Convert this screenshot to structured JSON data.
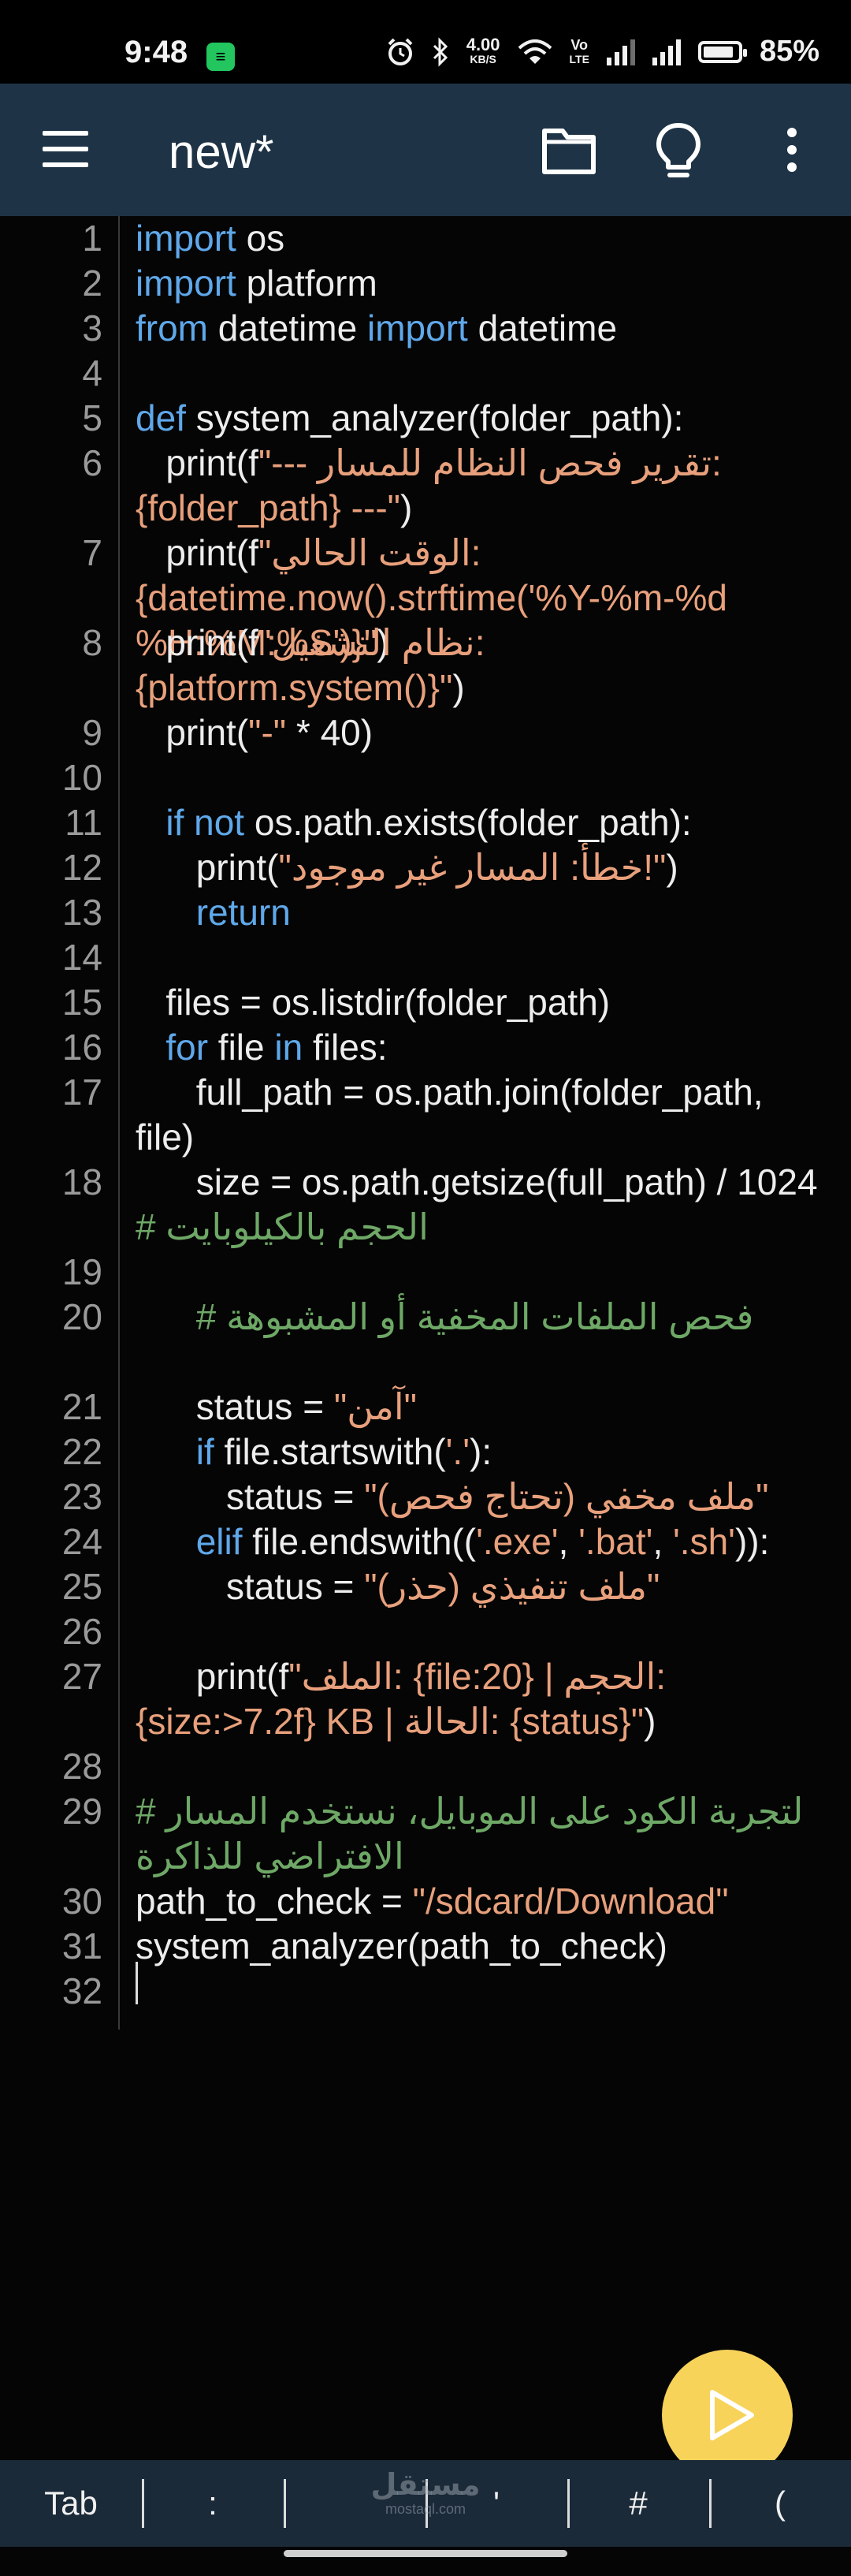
{
  "status_bar": {
    "time": "9:48",
    "app_icon_glyph": "≡",
    "alarm_icon": "alarm-icon",
    "bluetooth_icon": "bluetooth-icon",
    "net_speed_value": "4.00",
    "net_speed_unit": "KB/S",
    "wifi_icon": "wifi-icon",
    "volte_top": "Vo",
    "volte_bottom": "LTE",
    "battery_percent": "85%",
    "battery_level": 0.85
  },
  "toolbar": {
    "menu_icon": "menu-icon",
    "title": "new*",
    "folder_icon": "folder-icon",
    "bulb_icon": "lightbulb-icon",
    "more_icon": "more-vert-icon"
  },
  "editor": {
    "lines": [
      {
        "n": "1",
        "parts": [
          {
            "t": "import",
            "c": "kw"
          },
          {
            "t": " os",
            "c": ""
          }
        ]
      },
      {
        "n": "2",
        "parts": [
          {
            "t": "import",
            "c": "kw"
          },
          {
            "t": " platform",
            "c": ""
          }
        ]
      },
      {
        "n": "3",
        "parts": [
          {
            "t": "from",
            "c": "kw"
          },
          {
            "t": " datetime ",
            "c": ""
          },
          {
            "t": "import",
            "c": "kw"
          },
          {
            "t": " datetime",
            "c": ""
          }
        ]
      },
      {
        "n": "4",
        "parts": []
      },
      {
        "n": "5",
        "parts": [
          {
            "t": "def",
            "c": "kw"
          },
          {
            "t": " system_analyzer(folder_path):",
            "c": ""
          }
        ]
      },
      {
        "n": "6",
        "parts": [
          {
            "t": "   print(f",
            "c": ""
          },
          {
            "t": "\"--- تقرير فحص النظام للمسار: {folder_path} ---\"",
            "c": "str"
          },
          {
            "t": ")",
            "c": ""
          }
        ]
      },
      {
        "n": "7",
        "parts": [
          {
            "t": "   print(f",
            "c": ""
          },
          {
            "t": "\"الوقت الحالي: {datetime.now().strftime('%Y-%m-%d %H:%M:%S')}\"",
            "c": "str"
          },
          {
            "t": ")",
            "c": ""
          }
        ]
      },
      {
        "n": "8",
        "parts": [
          {
            "t": "   print(f",
            "c": ""
          },
          {
            "t": "\"نظام التشغيل: {platform.system()}\"",
            "c": "str"
          },
          {
            "t": ")",
            "c": ""
          }
        ]
      },
      {
        "n": "9",
        "parts": [
          {
            "t": "   print(",
            "c": ""
          },
          {
            "t": "\"-\"",
            "c": "str"
          },
          {
            "t": " * 40)",
            "c": ""
          }
        ]
      },
      {
        "n": "10",
        "parts": []
      },
      {
        "n": "11",
        "parts": [
          {
            "t": "   ",
            "c": ""
          },
          {
            "t": "if not",
            "c": "kw"
          },
          {
            "t": " os.path.exists(folder_path):",
            "c": ""
          }
        ]
      },
      {
        "n": "12",
        "parts": [
          {
            "t": "      print(",
            "c": ""
          },
          {
            "t": "\"خطأ: المسار غير موجود!\"",
            "c": "str"
          },
          {
            "t": ")",
            "c": ""
          }
        ]
      },
      {
        "n": "13",
        "parts": [
          {
            "t": "      ",
            "c": ""
          },
          {
            "t": "return",
            "c": "kw"
          }
        ]
      },
      {
        "n": "14",
        "parts": []
      },
      {
        "n": "15",
        "parts": [
          {
            "t": "   files = os.listdir(folder_path)",
            "c": ""
          }
        ]
      },
      {
        "n": "16",
        "parts": [
          {
            "t": "   ",
            "c": ""
          },
          {
            "t": "for",
            "c": "kw"
          },
          {
            "t": " file ",
            "c": ""
          },
          {
            "t": "in",
            "c": "kw"
          },
          {
            "t": " files:",
            "c": ""
          }
        ]
      },
      {
        "n": "17",
        "parts": [
          {
            "t": "      full_path = os.path.join(folder_path, file)",
            "c": ""
          }
        ]
      },
      {
        "n": "18",
        "parts": [
          {
            "t": "      size = os.path.getsize(full_path) / 1024  ",
            "c": ""
          },
          {
            "t": "# الحجم بالكيلوبايت",
            "c": "cm"
          }
        ]
      },
      {
        "n": "19",
        "parts": []
      },
      {
        "n": "20",
        "parts": [
          {
            "t": "      ",
            "c": ""
          },
          {
            "t": "# فحص الملفات المخفية أو المشبوهة",
            "c": "cm"
          }
        ]
      },
      {
        "n": "21",
        "parts": [
          {
            "t": "      status = ",
            "c": ""
          },
          {
            "t": "\"آمن\"",
            "c": "str"
          }
        ]
      },
      {
        "n": "22",
        "parts": [
          {
            "t": "      ",
            "c": ""
          },
          {
            "t": "if",
            "c": "kw"
          },
          {
            "t": " file.startswith(",
            "c": ""
          },
          {
            "t": "'.'",
            "c": "str"
          },
          {
            "t": "):",
            "c": ""
          }
        ]
      },
      {
        "n": "23",
        "parts": [
          {
            "t": "         status = ",
            "c": ""
          },
          {
            "t": "\"ملف مخفي (تحتاج فحص)\"",
            "c": "str"
          }
        ]
      },
      {
        "n": "24",
        "parts": [
          {
            "t": "      ",
            "c": ""
          },
          {
            "t": "elif",
            "c": "kw"
          },
          {
            "t": " file.endswith((",
            "c": ""
          },
          {
            "t": "'.exe'",
            "c": "str"
          },
          {
            "t": ", ",
            "c": ""
          },
          {
            "t": "'.bat'",
            "c": "str"
          },
          {
            "t": ", ",
            "c": ""
          },
          {
            "t": "'.sh'",
            "c": "str"
          },
          {
            "t": ")):",
            "c": ""
          }
        ]
      },
      {
        "n": "25",
        "parts": [
          {
            "t": "         status = ",
            "c": ""
          },
          {
            "t": "\"ملف تنفيذي (حذر)\"",
            "c": "str"
          }
        ]
      },
      {
        "n": "26",
        "parts": []
      },
      {
        "n": "27",
        "parts": [
          {
            "t": "      print(f",
            "c": ""
          },
          {
            "t": "\"الملف: {file:20} | الحجم: {size:>7.2f} KB | الحالة: {status}\"",
            "c": "str"
          },
          {
            "t": ")",
            "c": ""
          }
        ]
      },
      {
        "n": "28",
        "parts": []
      },
      {
        "n": "29",
        "parts": [
          {
            "t": "# لتجربة الكود على الموبايل، نستخدم المسار الافتراضي للذاكرة",
            "c": "cm"
          }
        ]
      },
      {
        "n": "30",
        "parts": [
          {
            "t": "path_to_check = ",
            "c": ""
          },
          {
            "t": "\"/sdcard/Download\"",
            "c": "str"
          }
        ]
      },
      {
        "n": "31",
        "parts": [
          {
            "t": "system_analyzer(path_to_check)",
            "c": ""
          }
        ]
      },
      {
        "n": "32",
        "parts": []
      }
    ]
  },
  "run_button": {
    "icon": "play-icon"
  },
  "key_bar": {
    "keys": [
      "Tab",
      ":",
      "",
      "'",
      "#",
      "("
    ]
  },
  "watermark": {
    "title": "مستقل",
    "sub": "mostaql.com"
  }
}
